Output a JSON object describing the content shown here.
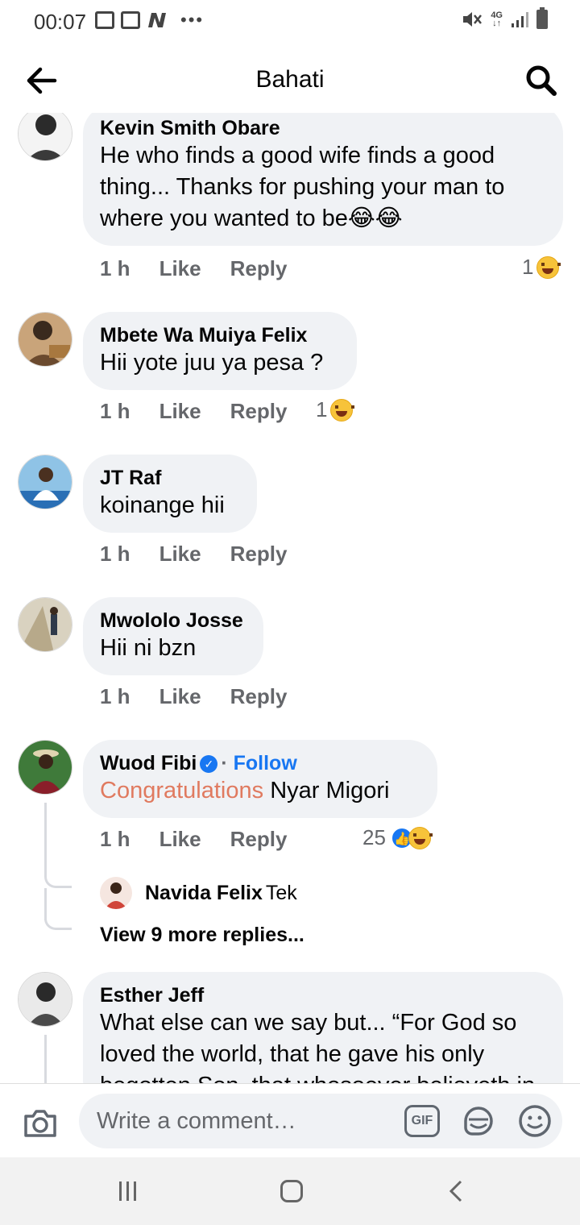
{
  "status_bar": {
    "time": "00:07",
    "network": "4G"
  },
  "header": {
    "title": "Bahati"
  },
  "comments": [
    {
      "name": "Kevin Smith Obare",
      "text": "He who finds a good wife finds a good thing... Thanks for pushing your man to where you wanted to be😂😂",
      "time": "1 h",
      "like": "Like",
      "reply": "Reply",
      "reaction_count": "1"
    },
    {
      "name": "Mbete Wa Muiya Felix",
      "text": "Hii yote juu ya pesa ?",
      "time": "1 h",
      "like": "Like",
      "reply": "Reply",
      "reaction_count": "1"
    },
    {
      "name": "JT Raf",
      "text": "koinange hii",
      "time": "1 h",
      "like": "Like",
      "reply": "Reply"
    },
    {
      "name": "Mwololo Josse",
      "text": "Hii ni bzn",
      "time": "1 h",
      "like": "Like",
      "reply": "Reply"
    },
    {
      "name": "Wuod Fibi",
      "follow": "Follow",
      "separator": "·",
      "text_highlight": "Congratulations",
      "text_rest": " Nyar Migori",
      "time": "1 h",
      "like": "Like",
      "reply": "Reply",
      "reaction_count": "25",
      "reply_preview": {
        "name": "Navida Felix",
        "text": "Tek"
      },
      "view_more": "View 9 more replies..."
    },
    {
      "name": "Esther Jeff",
      "text": "What else can we say but...  “For God so loved the world, that he gave his only begotten Son, that whosoever believeth in"
    }
  ],
  "comment_bar": {
    "placeholder": "Write a comment…",
    "gif_label": "GIF"
  },
  "colors": {
    "bubble": "#f0f2f5",
    "link_blue": "#1877f2",
    "highlight": "#e07a5f",
    "meta_gray": "#65676b"
  }
}
